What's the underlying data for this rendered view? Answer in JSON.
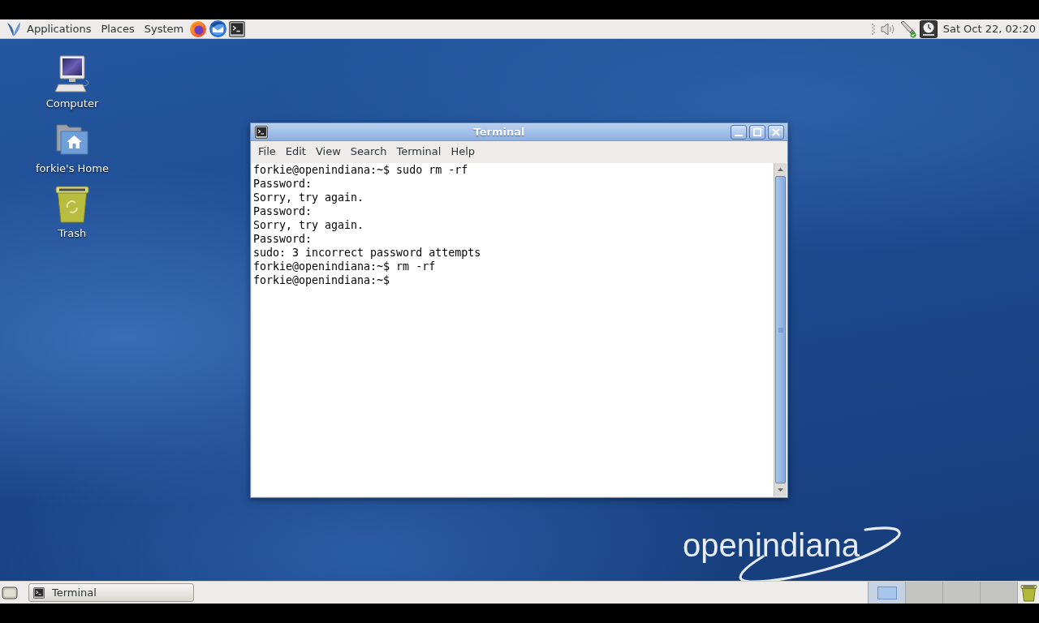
{
  "top_panel": {
    "menus": [
      {
        "label": "Applications"
      },
      {
        "label": "Places"
      },
      {
        "label": "System"
      }
    ],
    "clock": "Sat Oct 22, 02:20"
  },
  "desktop_icons": [
    {
      "kind": "computer",
      "label": "Computer"
    },
    {
      "kind": "home",
      "label": "forkie's Home"
    },
    {
      "kind": "trash",
      "label": "Trash"
    }
  ],
  "window": {
    "title": "Terminal",
    "menu": [
      "File",
      "Edit",
      "View",
      "Search",
      "Terminal",
      "Help"
    ],
    "lines": [
      "forkie@openindiana:~$ sudo rm -rf",
      "Password:",
      "Sorry, try again.",
      "Password:",
      "Sorry, try again.",
      "Password:",
      "sudo: 3 incorrect password attempts",
      "forkie@openindiana:~$ rm -rf",
      "forkie@openindiana:~$"
    ]
  },
  "logo": "openindiana",
  "bottom_panel": {
    "tasks": [
      {
        "label": "Terminal"
      }
    ],
    "workspaces": [
      {
        "selected": true,
        "has_window": true
      },
      {
        "selected": false,
        "has_window": false
      },
      {
        "selected": false,
        "has_window": false
      },
      {
        "selected": false,
        "has_window": false
      }
    ]
  }
}
